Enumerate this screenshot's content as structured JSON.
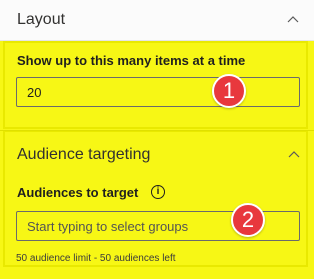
{
  "layout_section": {
    "title": "Layout",
    "chevron_icon": "chevron-up-icon",
    "items_label": "Show up to this many items at a time",
    "items_value": "20"
  },
  "audience_section": {
    "title": "Audience targeting",
    "chevron_icon": "chevron-up-icon",
    "audiences_label": "Audiences to target",
    "info_icon": "info-icon",
    "info_glyph": "i",
    "audiences_placeholder": "Start typing to select groups",
    "helper_text": "50 audience limit - 50 audiences left"
  },
  "callouts": {
    "badge_1": "1",
    "badge_2": "2"
  },
  "colors": {
    "highlight": "#f7f715",
    "badge": "#e8383d"
  }
}
